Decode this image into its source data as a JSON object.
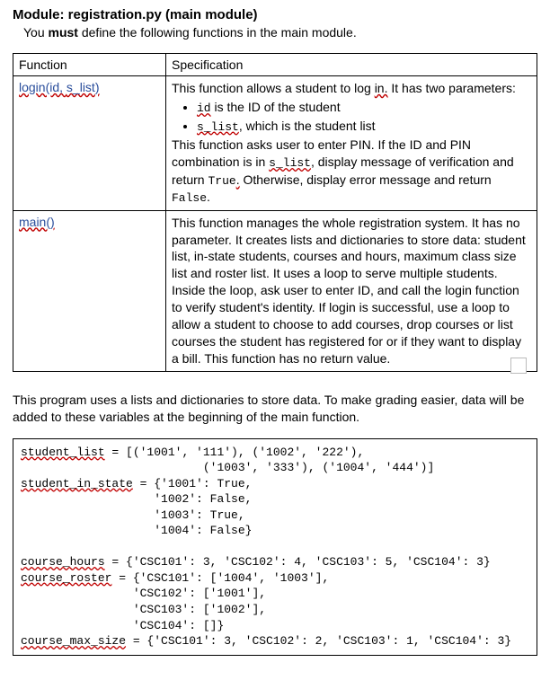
{
  "header": {
    "module_label": "Module:",
    "module_name": "registration.py (main module)",
    "sub_pre": "You",
    "sub_bold": "must",
    "sub_post": "define the following functions in the main module."
  },
  "table": {
    "h_function": "Function",
    "h_spec": "Specification",
    "row1": {
      "fn_pre": "login(id,",
      "fn_arg2": "s_list",
      "fn_post": ")",
      "spec_l1a": "This function allows a student to log",
      "spec_l1b": "in.",
      "spec_l1c": "It has two parameters:",
      "bullet1_code": "id",
      "bullet1_txt": "is the ID of the student",
      "bullet2_code": "s_list",
      "bullet2_post": ", which is the student list",
      "spec_l2a": "This function asks user to enter PIN. If the ID and PIN combination is in",
      "spec_l2b": "s_list",
      "spec_l2c": ", display message of verification and return",
      "spec_l2d": "True",
      "spec_l2e": ".",
      "spec_l2f": "Otherwise, display error message and return",
      "spec_l2g": "False",
      "spec_l2h": "."
    },
    "row2": {
      "fn": "main()",
      "spec": "This function manages the whole registration system.  It has no parameter.  It creates lists and dictionaries to store data: student list, in-state students, courses and hours, maximum class size list and roster list.  It uses a loop to serve multiple students.  Inside the loop, ask user to enter ID, and call the login function to verify student's identity.  If login is successful, use a loop to allow a student to choose to add courses, drop courses or list courses the student has registered for or if they want to display a bill. This function has no return value."
    }
  },
  "intertext": "This program uses a lists and dictionaries to store data. To make grading easier, data will be added to these variables at the beginning of the main function.",
  "code": {
    "v1": "student_list",
    "l1": " = [('1001', '111'), ('1002', '222'),",
    "l2": "                          ('1003', '333'), ('1004', '444')]",
    "v2": "student_in_state",
    "l3": " = {'1001': True,",
    "l4": "                   '1002': False,",
    "l5": "                   '1003': True,",
    "l6": "                   '1004': False}",
    "blank": " ",
    "v3": "course_hours",
    "l7": " = {'CSC101': 3, 'CSC102': 4, 'CSC103': 5, 'CSC104': 3}",
    "v4": "course_roster",
    "l8": " = {'CSC101': ['1004', '1003'],",
    "l9": "                'CSC102': ['1001'],",
    "l10": "                'CSC103': ['1002'],",
    "l11": "                'CSC104': []}",
    "v5": "course_max_size",
    "l12": " = {'CSC101': 3, 'CSC102': 2, 'CSC103': 1, 'CSC104': 3}"
  }
}
